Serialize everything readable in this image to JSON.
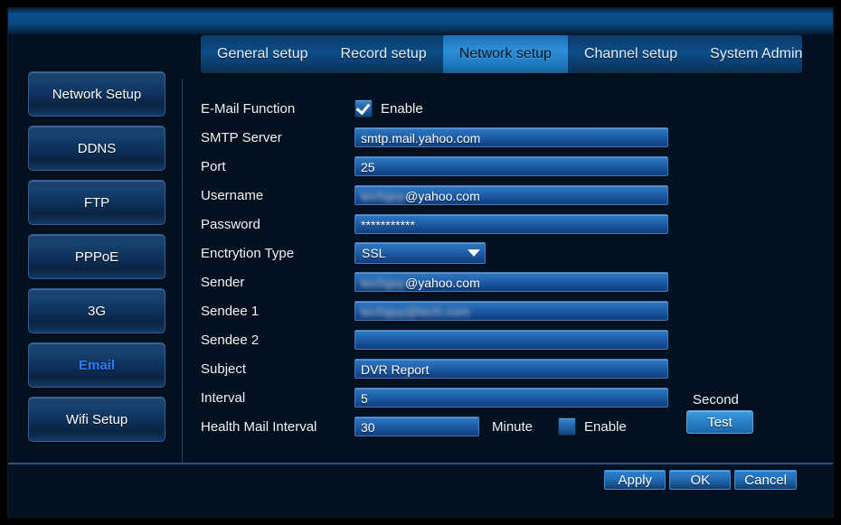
{
  "window": {
    "title": ""
  },
  "tabs": [
    {
      "label": "General setup",
      "active": false
    },
    {
      "label": "Record setup",
      "active": false
    },
    {
      "label": "Network setup",
      "active": true
    },
    {
      "label": "Channel setup",
      "active": false
    },
    {
      "label": "System Admin",
      "active": false
    }
  ],
  "sidebar": {
    "items": [
      {
        "label": "Network Setup",
        "selected": false
      },
      {
        "label": "DDNS",
        "selected": false
      },
      {
        "label": "FTP",
        "selected": false
      },
      {
        "label": "PPPoE",
        "selected": false
      },
      {
        "label": "3G",
        "selected": false
      },
      {
        "label": "Email",
        "selected": true
      },
      {
        "label": "Wifi Setup",
        "selected": false
      }
    ]
  },
  "form": {
    "email_function": {
      "label": "E-Mail Function",
      "checkbox_label": "Enable",
      "checked": true
    },
    "smtp_server": {
      "label": "SMTP Server",
      "value": "smtp.mail.yahoo.com"
    },
    "port": {
      "label": "Port",
      "value": "25"
    },
    "username": {
      "label": "Username",
      "redacted": "techguy",
      "value": "@yahoo.com"
    },
    "password": {
      "label": "Password",
      "value": "***********"
    },
    "encryption_type": {
      "label": "Enctrytion Type",
      "value": "SSL"
    },
    "sender": {
      "label": "Sender",
      "redacted": "techguy",
      "value": "@yahoo.com"
    },
    "sendee1": {
      "label": "Sendee 1",
      "redacted": "techguy@tech.com",
      "value": ""
    },
    "sendee2": {
      "label": "Sendee 2",
      "value": ""
    },
    "subject": {
      "label": "Subject",
      "value": "DVR Report"
    },
    "interval": {
      "label": "Interval",
      "value": "5",
      "unit": "Second"
    },
    "health_mail_interval": {
      "label": "Health Mail Interval",
      "value": "30",
      "unit": "Minute",
      "checkbox_label": "Enable",
      "checked": false
    },
    "test_button": "Test"
  },
  "footer": {
    "apply": "Apply",
    "ok": "OK",
    "cancel": "Cancel"
  },
  "colors": {
    "background": "#01111f",
    "accent": "#2b7cff",
    "field": "#2569b2",
    "tab_active": "#2e8fd8"
  }
}
